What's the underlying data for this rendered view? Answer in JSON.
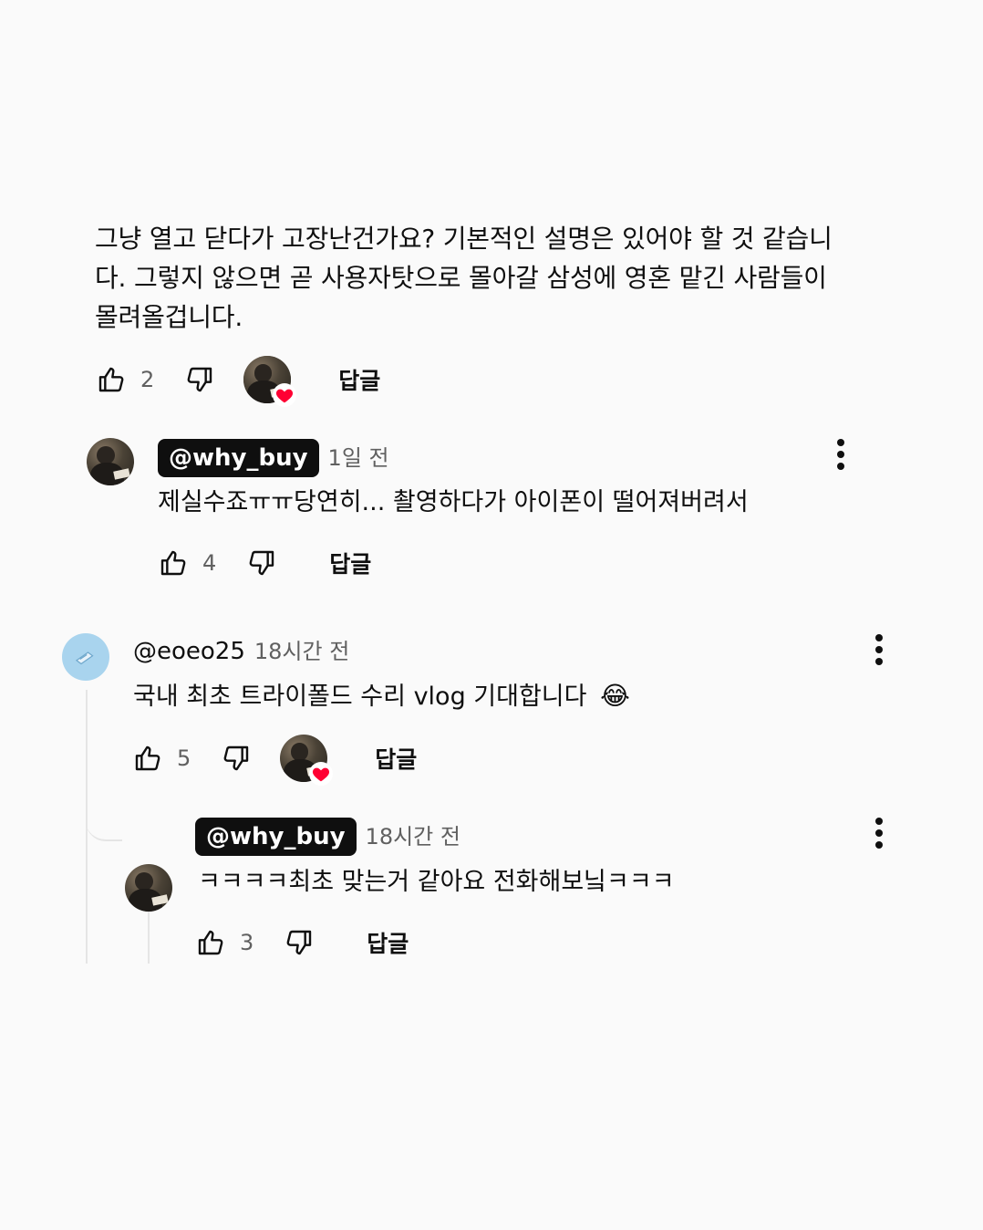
{
  "comment1": {
    "text_line1": "그냥 열고 닫다가 고장난건가요? 기본적인 설명은 있어야 할 것 같습니",
    "text_line2": "다. 그렇지 않으면 곧 사용자탓으로 몰아갈 삼성에 영혼 맡긴 사람들이",
    "text_line3": "몰려올겁니다.",
    "likes": "2",
    "reply_label": "답글",
    "creator_heart": true
  },
  "reply1": {
    "handle": "@why_buy",
    "time": "1일 전",
    "text": "제실수죠ㅠㅠ당연히... 촬영하다가 아이폰이 떨어져버려서",
    "likes": "4",
    "reply_label": "답글"
  },
  "comment2": {
    "handle": "@eoeo25",
    "time": "18시간 전",
    "text": "국내 최초 트라이폴드 수리 vlog 기대합니다",
    "emoji": "😂",
    "likes": "5",
    "reply_label": "답글",
    "creator_heart": true
  },
  "reply2": {
    "handle": "@why_buy",
    "time": "18시간 전",
    "text": "ㅋㅋㅋㅋ최초 맞는거 같아요 전화해보닠ㅋㅋㅋ",
    "likes": "3",
    "reply_label": "답글"
  },
  "colors": {
    "background": "#fafafa",
    "text": "#0f0f0f",
    "meta": "#606060",
    "heart": "#ff0033",
    "handle_pill": "#0f0f0f"
  }
}
